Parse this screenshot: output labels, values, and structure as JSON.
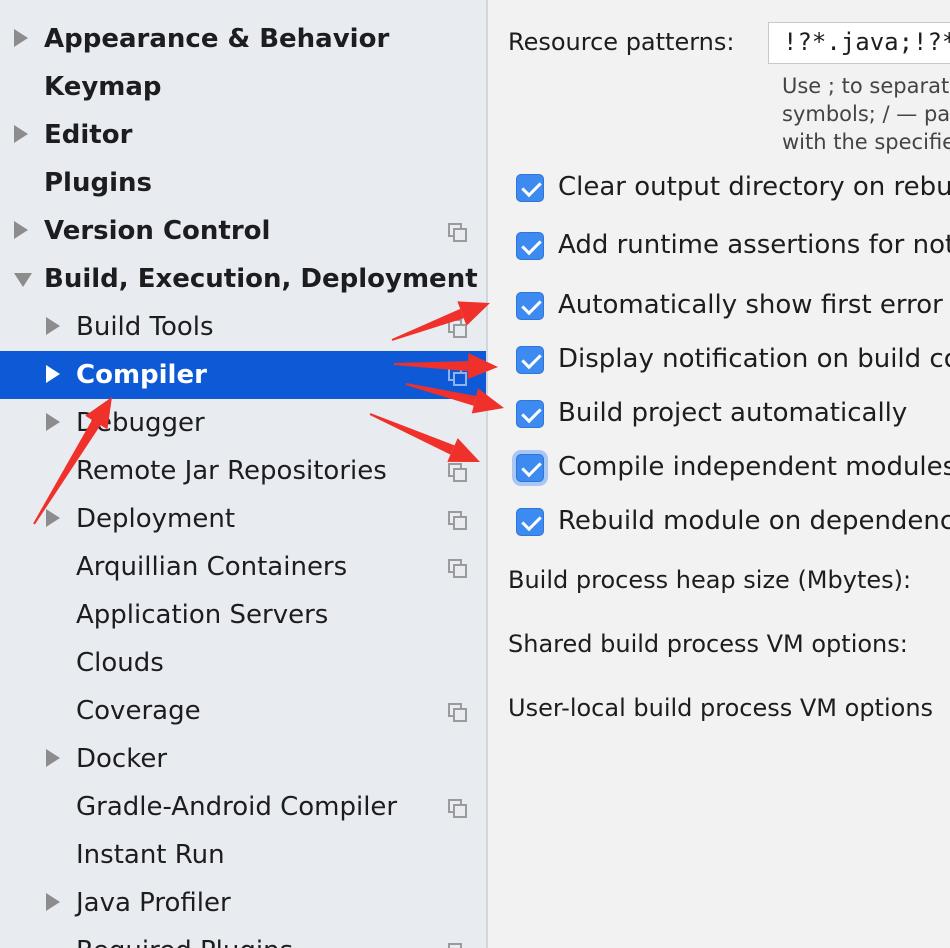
{
  "sidebar": {
    "items": [
      {
        "label": "Appearance & Behavior",
        "bold": true,
        "level": 0,
        "arrow": "right",
        "proj_icon": false,
        "selected": false
      },
      {
        "label": "Keymap",
        "bold": true,
        "level": 0,
        "arrow": "none",
        "proj_icon": false,
        "selected": false
      },
      {
        "label": "Editor",
        "bold": true,
        "level": 0,
        "arrow": "right",
        "proj_icon": false,
        "selected": false
      },
      {
        "label": "Plugins",
        "bold": true,
        "level": 0,
        "arrow": "none",
        "proj_icon": false,
        "selected": false
      },
      {
        "label": "Version Control",
        "bold": true,
        "level": 0,
        "arrow": "right",
        "proj_icon": true,
        "selected": false
      },
      {
        "label": "Build, Execution, Deployment",
        "bold": true,
        "level": 0,
        "arrow": "down",
        "proj_icon": false,
        "selected": false
      },
      {
        "label": "Build Tools",
        "bold": false,
        "level": 1,
        "arrow": "right",
        "proj_icon": true,
        "selected": false
      },
      {
        "label": "Compiler",
        "bold": false,
        "level": 1,
        "arrow": "right",
        "proj_icon": true,
        "selected": true
      },
      {
        "label": "Debugger",
        "bold": false,
        "level": 1,
        "arrow": "right",
        "proj_icon": false,
        "selected": false
      },
      {
        "label": "Remote Jar Repositories",
        "bold": false,
        "level": 1,
        "arrow": "none",
        "proj_icon": true,
        "selected": false
      },
      {
        "label": "Deployment",
        "bold": false,
        "level": 1,
        "arrow": "right",
        "proj_icon": true,
        "selected": false
      },
      {
        "label": "Arquillian Containers",
        "bold": false,
        "level": 1,
        "arrow": "none",
        "proj_icon": true,
        "selected": false
      },
      {
        "label": "Application Servers",
        "bold": false,
        "level": 1,
        "arrow": "none",
        "proj_icon": false,
        "selected": false
      },
      {
        "label": "Clouds",
        "bold": false,
        "level": 1,
        "arrow": "none",
        "proj_icon": false,
        "selected": false
      },
      {
        "label": "Coverage",
        "bold": false,
        "level": 1,
        "arrow": "none",
        "proj_icon": true,
        "selected": false
      },
      {
        "label": "Docker",
        "bold": false,
        "level": 1,
        "arrow": "right",
        "proj_icon": false,
        "selected": false
      },
      {
        "label": "Gradle-Android Compiler",
        "bold": false,
        "level": 1,
        "arrow": "none",
        "proj_icon": true,
        "selected": false
      },
      {
        "label": "Instant Run",
        "bold": false,
        "level": 1,
        "arrow": "none",
        "proj_icon": false,
        "selected": false
      },
      {
        "label": "Java Profiler",
        "bold": false,
        "level": 1,
        "arrow": "right",
        "proj_icon": false,
        "selected": false
      },
      {
        "label": "Required Plugins",
        "bold": false,
        "level": 1,
        "arrow": "none",
        "proj_icon": true,
        "selected": false
      }
    ]
  },
  "compiler": {
    "resource_patterns_label": "Resource patterns:",
    "resource_patterns_value": "!?*.java;!?*.fo",
    "hint_lines": [
      "Use ; to separate",
      "symbols; / — pa",
      "with the specifie"
    ],
    "checkboxes": [
      {
        "label": "Clear output directory on rebuild",
        "checked": true,
        "focused": false
      },
      {
        "label": "Add runtime assertions for notnull",
        "checked": true,
        "focused": false
      },
      {
        "label": "Automatically show first error in editor",
        "checked": true,
        "focused": false
      },
      {
        "label": "Display notification on build completion",
        "checked": true,
        "focused": false
      },
      {
        "label": "Build project automatically",
        "checked": true,
        "focused": false
      },
      {
        "label": "Compile independent modules in parallel",
        "checked": true,
        "focused": true
      },
      {
        "label": "Rebuild module on dependency change",
        "checked": true,
        "focused": false
      }
    ],
    "heap_size_label": "Build process heap size (Mbytes):",
    "shared_vm_label": "Shared build process VM options:",
    "user_local_vm_label": "User-local build process VM options"
  },
  "colors": {
    "selection": "#0e5ad6",
    "checkbox": "#3d8bf0",
    "annotation_arrow": "#f0302a"
  },
  "annotations": [
    "arrow",
    "arrow",
    "arrow",
    "arrow",
    "arrow",
    "arrow"
  ]
}
